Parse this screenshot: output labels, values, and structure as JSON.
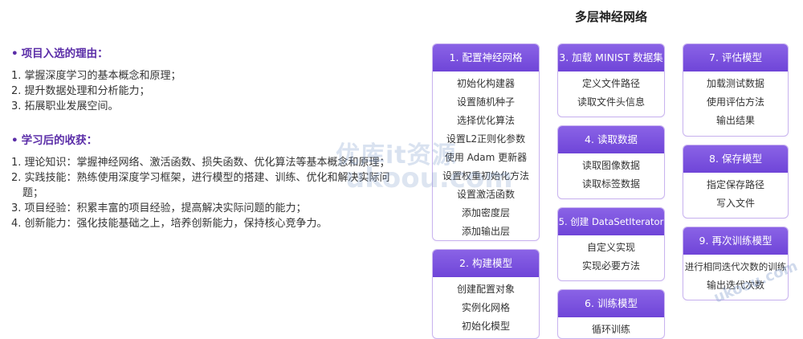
{
  "left": {
    "section1": {
      "bullet": "•",
      "title": "项目入选的理由：",
      "items": [
        "1. 掌握深度学习的基本概念和原理；",
        "2. 提升数据处理和分析能力；",
        "3. 拓展职业发展空间。"
      ]
    },
    "section2": {
      "bullet": "•",
      "title": "学习后的收获：",
      "items": [
        "1. 理论知识：掌握神经网络、激活函数、损失函数、优化算法等基本概念和原理；",
        "2. 实践技能：熟练使用深度学习框架，进行模型的搭建、训练、优化和解决实际问",
        "题；",
        "3. 项目经验：积累丰富的项目经验，提高解决实际问题的能力；",
        "4. 创新能力：强化技能基础之上，培养创新能力，保持核心竞争力。"
      ]
    }
  },
  "diagram": {
    "title": "多层神经网络",
    "cards": [
      {
        "title": "1. 配置神经网格",
        "items": [
          "初始化构建器",
          "设置随机种子",
          "选择优化算法",
          "设置L2正则化参数",
          "使用 Adam 更新器",
          "设置权重初始化方法",
          "设置激活函数",
          "添加密度层",
          "添加输出层"
        ]
      },
      {
        "title": "2. 构建模型",
        "items": [
          "创建配置对象",
          "实例化网格",
          "初始化模型"
        ]
      },
      {
        "title": "3. 加载 MINIST 数据集",
        "items": [
          "定义文件路径",
          "读取文件头信息"
        ]
      },
      {
        "title": "4. 读取数据",
        "items": [
          "读取图像数据",
          "读取标签数据"
        ]
      },
      {
        "title": "5. 创建 DataSetIterator",
        "items": [
          "自定义实现",
          "实现必要方法"
        ]
      },
      {
        "title": "6. 训练模型",
        "items": [
          "循环训练"
        ]
      },
      {
        "title": "7. 评估模型",
        "items": [
          "加载测试数据",
          "使用评估方法",
          "输出结果"
        ]
      },
      {
        "title": "8. 保存模型",
        "items": [
          "指定保存路径",
          "写入文件"
        ]
      },
      {
        "title": "9. 再次训练模型",
        "items": [
          "进行相同迭代次数的训练",
          "输出迭代次数"
        ]
      }
    ]
  },
  "watermark": {
    "text1": "优库it资源",
    "text2": "ukoou.com",
    "text3": "ukoou.com"
  }
}
